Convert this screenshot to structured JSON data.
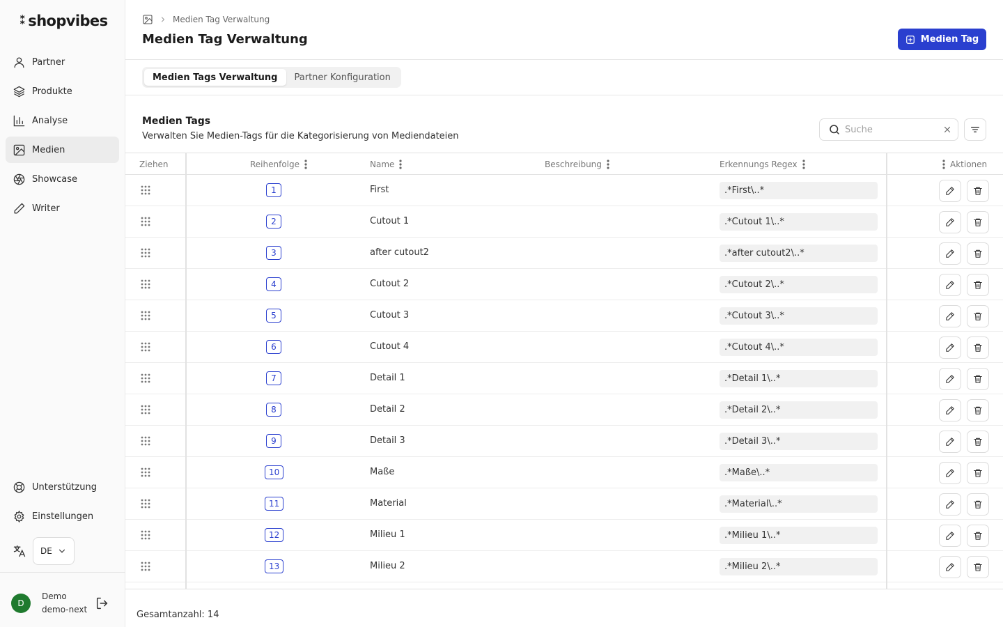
{
  "brand": {
    "logo_text": "shopvibes"
  },
  "sidebar": {
    "items": [
      {
        "label": "Partner",
        "icon": "user-icon",
        "active": false
      },
      {
        "label": "Produkte",
        "icon": "layers-icon",
        "active": false
      },
      {
        "label": "Analyse",
        "icon": "bar-chart-icon",
        "active": false
      },
      {
        "label": "Medien",
        "icon": "image-icon",
        "active": true
      },
      {
        "label": "Showcase",
        "icon": "aperture-icon",
        "active": false
      },
      {
        "label": "Writer",
        "icon": "pen-icon",
        "active": false
      }
    ],
    "bottom_items": [
      {
        "label": "Unterstützung",
        "icon": "lifebuoy-icon"
      },
      {
        "label": "Einstellungen",
        "icon": "gear-icon"
      }
    ],
    "language": {
      "icon": "translate-icon",
      "value": "DE"
    },
    "user": {
      "initial": "D",
      "name": "Demo",
      "account": "demo-next"
    }
  },
  "header": {
    "breadcrumb": {
      "icon": "image-icon",
      "current": "Medien Tag Verwaltung"
    },
    "title": "Medien Tag Verwaltung",
    "primary_button": "Medien Tag"
  },
  "tabs": [
    {
      "label": "Medien Tags Verwaltung",
      "active": true
    },
    {
      "label": "Partner Konfiguration",
      "active": false
    }
  ],
  "section": {
    "title": "Medien Tags",
    "description": "Verwalten Sie Medien-Tags für die Kategorisierung von Mediendateien"
  },
  "search": {
    "placeholder": "Suche",
    "value": ""
  },
  "table": {
    "columns": {
      "drag": "Ziehen",
      "order": "Reihenfolge",
      "name": "Name",
      "description": "Beschreibung",
      "regex": "Erkennungs Regex",
      "actions": "Aktionen"
    },
    "rows": [
      {
        "order": "1",
        "name": "First",
        "description": "",
        "regex": ".*First\\..*"
      },
      {
        "order": "2",
        "name": "Cutout 1",
        "description": "",
        "regex": ".*Cutout 1\\..*"
      },
      {
        "order": "3",
        "name": "after cutout2",
        "description": "",
        "regex": ".*after cutout2\\..*"
      },
      {
        "order": "4",
        "name": "Cutout 2",
        "description": "",
        "regex": ".*Cutout 2\\..*"
      },
      {
        "order": "5",
        "name": "Cutout 3",
        "description": "",
        "regex": ".*Cutout 3\\..*"
      },
      {
        "order": "6",
        "name": "Cutout 4",
        "description": "",
        "regex": ".*Cutout 4\\..*"
      },
      {
        "order": "7",
        "name": "Detail 1",
        "description": "",
        "regex": ".*Detail 1\\..*"
      },
      {
        "order": "8",
        "name": "Detail 2",
        "description": "",
        "regex": ".*Detail 2\\..*"
      },
      {
        "order": "9",
        "name": "Detail 3",
        "description": "",
        "regex": ".*Detail 3\\..*"
      },
      {
        "order": "10",
        "name": "Maße",
        "description": "",
        "regex": ".*Maße\\..*"
      },
      {
        "order": "11",
        "name": "Material",
        "description": "",
        "regex": ".*Material\\..*"
      },
      {
        "order": "12",
        "name": "Milieu 1",
        "description": "",
        "regex": ".*Milieu 1\\..*"
      },
      {
        "order": "13",
        "name": "Milieu 2",
        "description": "",
        "regex": ".*Milieu 2\\..*"
      }
    ]
  },
  "footer": {
    "total": "Gesamtanzahl: 14"
  },
  "colors": {
    "accent": "#2a3fcf",
    "avatar": "#1f7a2e"
  }
}
